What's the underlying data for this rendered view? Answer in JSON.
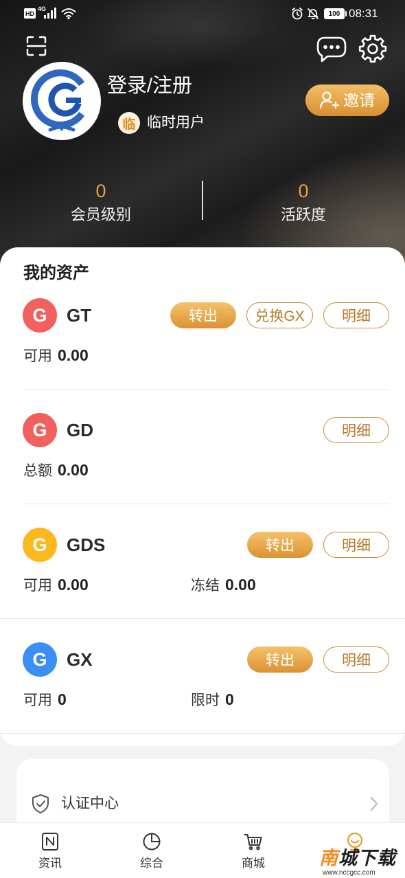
{
  "status_bar": {
    "hd": "HD",
    "network": "4G",
    "battery": "100",
    "time": "08:31"
  },
  "header": {
    "login_label": "登录/注册",
    "badge_char": "临",
    "user_type": "临时用户",
    "invite_label": "邀请",
    "stats": [
      {
        "value": "0",
        "label": "会员级别"
      },
      {
        "value": "0",
        "label": "活跃度"
      }
    ]
  },
  "assets": {
    "title": "我的资产",
    "items": [
      {
        "icon_letter": "G",
        "color": "#f06160",
        "name": "GT",
        "buttons": [
          {
            "label": "转出",
            "primary": true
          },
          {
            "label": "兑换GX",
            "primary": false
          },
          {
            "label": "明细",
            "primary": false
          }
        ],
        "fields": [
          {
            "label": "可用",
            "value": "0.00"
          }
        ]
      },
      {
        "icon_letter": "G",
        "color": "#f06160",
        "name": "GD",
        "buttons": [
          {
            "label": "明细",
            "primary": false
          }
        ],
        "fields": [
          {
            "label": "总额",
            "value": "0.00"
          }
        ]
      },
      {
        "icon_letter": "G",
        "color": "#fbb81f",
        "name": "GDS",
        "buttons": [
          {
            "label": "转出",
            "primary": true
          },
          {
            "label": "明细",
            "primary": false
          }
        ],
        "fields": [
          {
            "label": "可用",
            "value": "0.00"
          },
          {
            "label": "冻结",
            "value": "0.00"
          }
        ]
      },
      {
        "icon_letter": "G",
        "color": "#3c8ff2",
        "name": "GX",
        "buttons": [
          {
            "label": "转出",
            "primary": true
          },
          {
            "label": "明细",
            "primary": false
          }
        ],
        "fields": [
          {
            "label": "可用",
            "value": "0"
          },
          {
            "label": "限时",
            "value": "0"
          }
        ]
      }
    ]
  },
  "menu": {
    "items": [
      {
        "icon": "shield-check-icon",
        "label": "认证中心"
      }
    ]
  },
  "bottom_nav": {
    "items": [
      {
        "icon": "newspaper-icon",
        "label": "资讯"
      },
      {
        "icon": "pie-chart-icon",
        "label": "综合"
      },
      {
        "icon": "shopping-cart-icon",
        "label": "商城"
      },
      {
        "icon": "smiley-icon",
        "active": true
      }
    ]
  },
  "watermark": {
    "brand": "南城下载",
    "url": "www.nccgcc.com"
  },
  "colors": {
    "accent": "#e0a040",
    "accent_text": "#b8782a",
    "header_bg": "#1f1f1f",
    "page_bg": "#f3f3f3"
  }
}
